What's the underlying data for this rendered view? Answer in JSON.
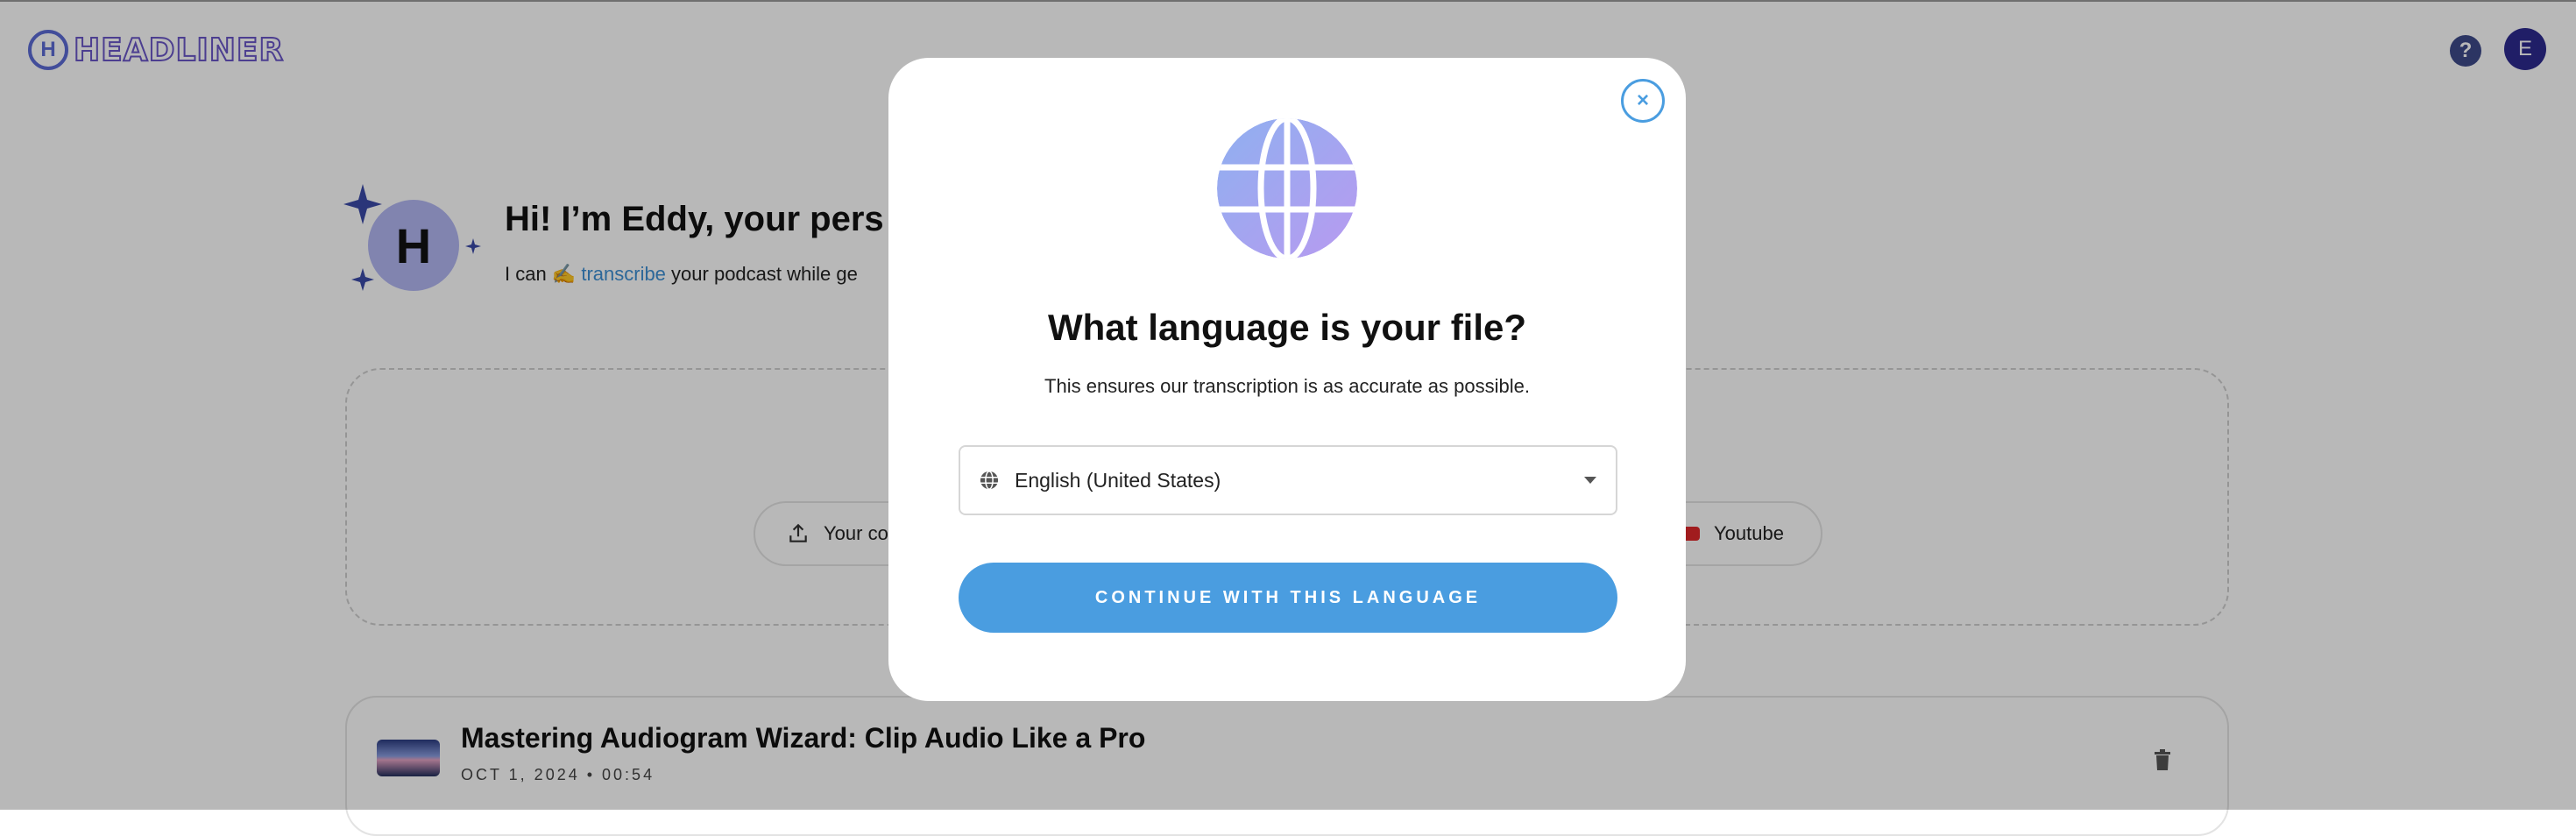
{
  "header": {
    "logo_letter": "H",
    "logo_text": "HEADLINER",
    "help_symbol": "?",
    "avatar_initial": "E",
    "icons": {
      "help": "question-icon",
      "avatar": "user-avatar"
    }
  },
  "greeting": {
    "title": "Hi! I’m Eddy, your pers",
    "sub_prefix": "I can ✍️",
    "sub_link": "transcribe",
    "sub_suffix": "your podcast while ge",
    "mascot_letter": "H"
  },
  "upload": {
    "from_computer_label": "Your co",
    "youtube_label": "Youtube",
    "icons": {
      "upload": "upload-icon",
      "youtube": "youtube-icon"
    }
  },
  "project": {
    "title": "Mastering Audiogram Wizard: Clip Audio Like a Pro",
    "meta": "OCT 1, 2024 • 00:54",
    "icons": {
      "delete": "trash-icon"
    }
  },
  "modal": {
    "close_symbol": "×",
    "title": "What language is your file?",
    "subtitle": "This ensures our transcription is as accurate as possible.",
    "selected_language": "English (United States)",
    "continue_label": "CONTINUE WITH THIS LANGUAGE",
    "icons": {
      "hero": "globe-icon",
      "select": "globe-icon",
      "caret": "chevron-down-icon",
      "close": "close-icon"
    }
  },
  "colors": {
    "accent": "#4a9de0",
    "overlay": "rgba(0,0,0,0.28)",
    "globe_gradient_start": "#8fb0f0",
    "globe_gradient_end": "#b89af0",
    "avatar_bg": "#2d2a8f",
    "youtube_red": "#e0282a"
  }
}
